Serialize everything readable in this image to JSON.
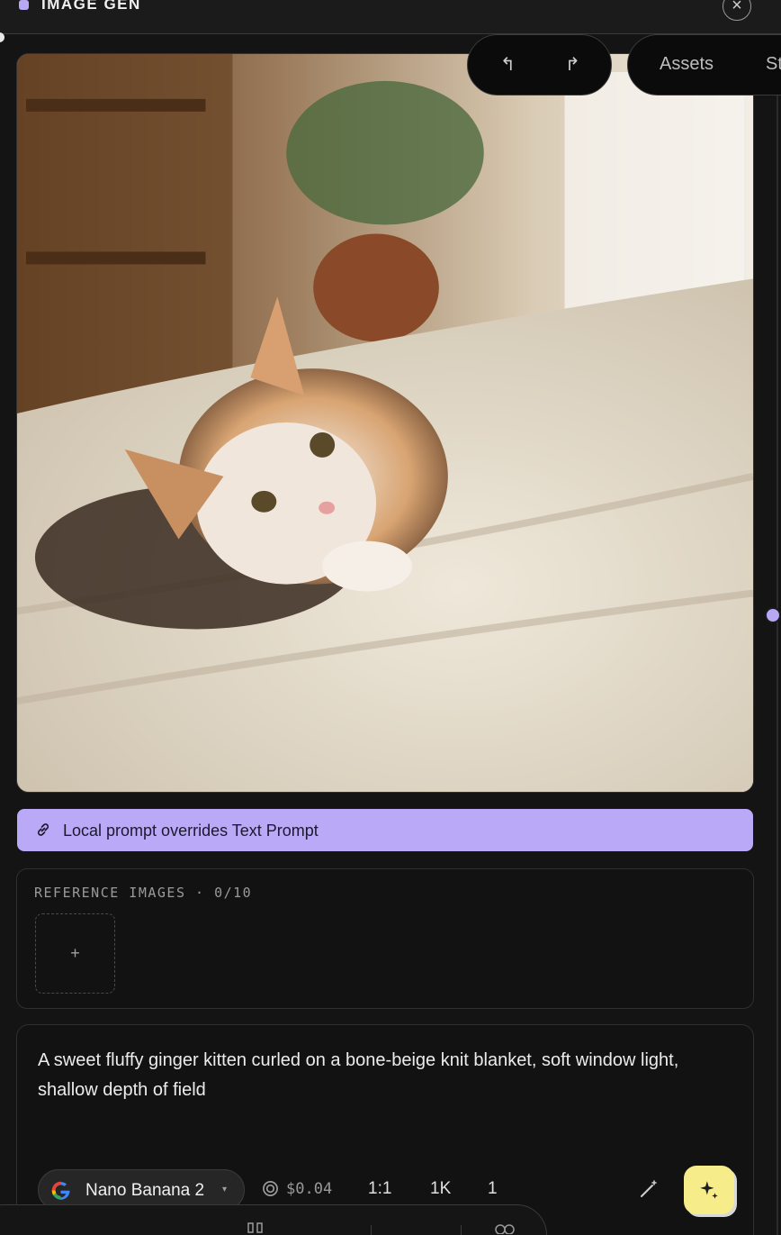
{
  "header": {
    "title": "IMAGE GEN",
    "close_icon": "close-icon",
    "accent": "#b7a7f5"
  },
  "toolbar": {
    "undo_glyph": "↰",
    "redo_glyph": "↱",
    "tabs": [
      "Assets",
      "St"
    ]
  },
  "banner": {
    "text": "Local prompt overrides Text Prompt",
    "icon": "link-icon",
    "color": "#b9a9f6"
  },
  "references": {
    "title": "REFERENCE IMAGES · 0/10",
    "add_label": "+"
  },
  "prompt": {
    "text": "A sweet fluffy ginger kitten curled on a bone-beige knit blanket, soft window light, shallow depth of field",
    "model": "Nano Banana 2",
    "model_caret": "▾",
    "cost": "$0.04",
    "aspect_ratio": "1:1",
    "resolution": "1K",
    "count": "1",
    "generate_color": "#f7ec8a"
  }
}
